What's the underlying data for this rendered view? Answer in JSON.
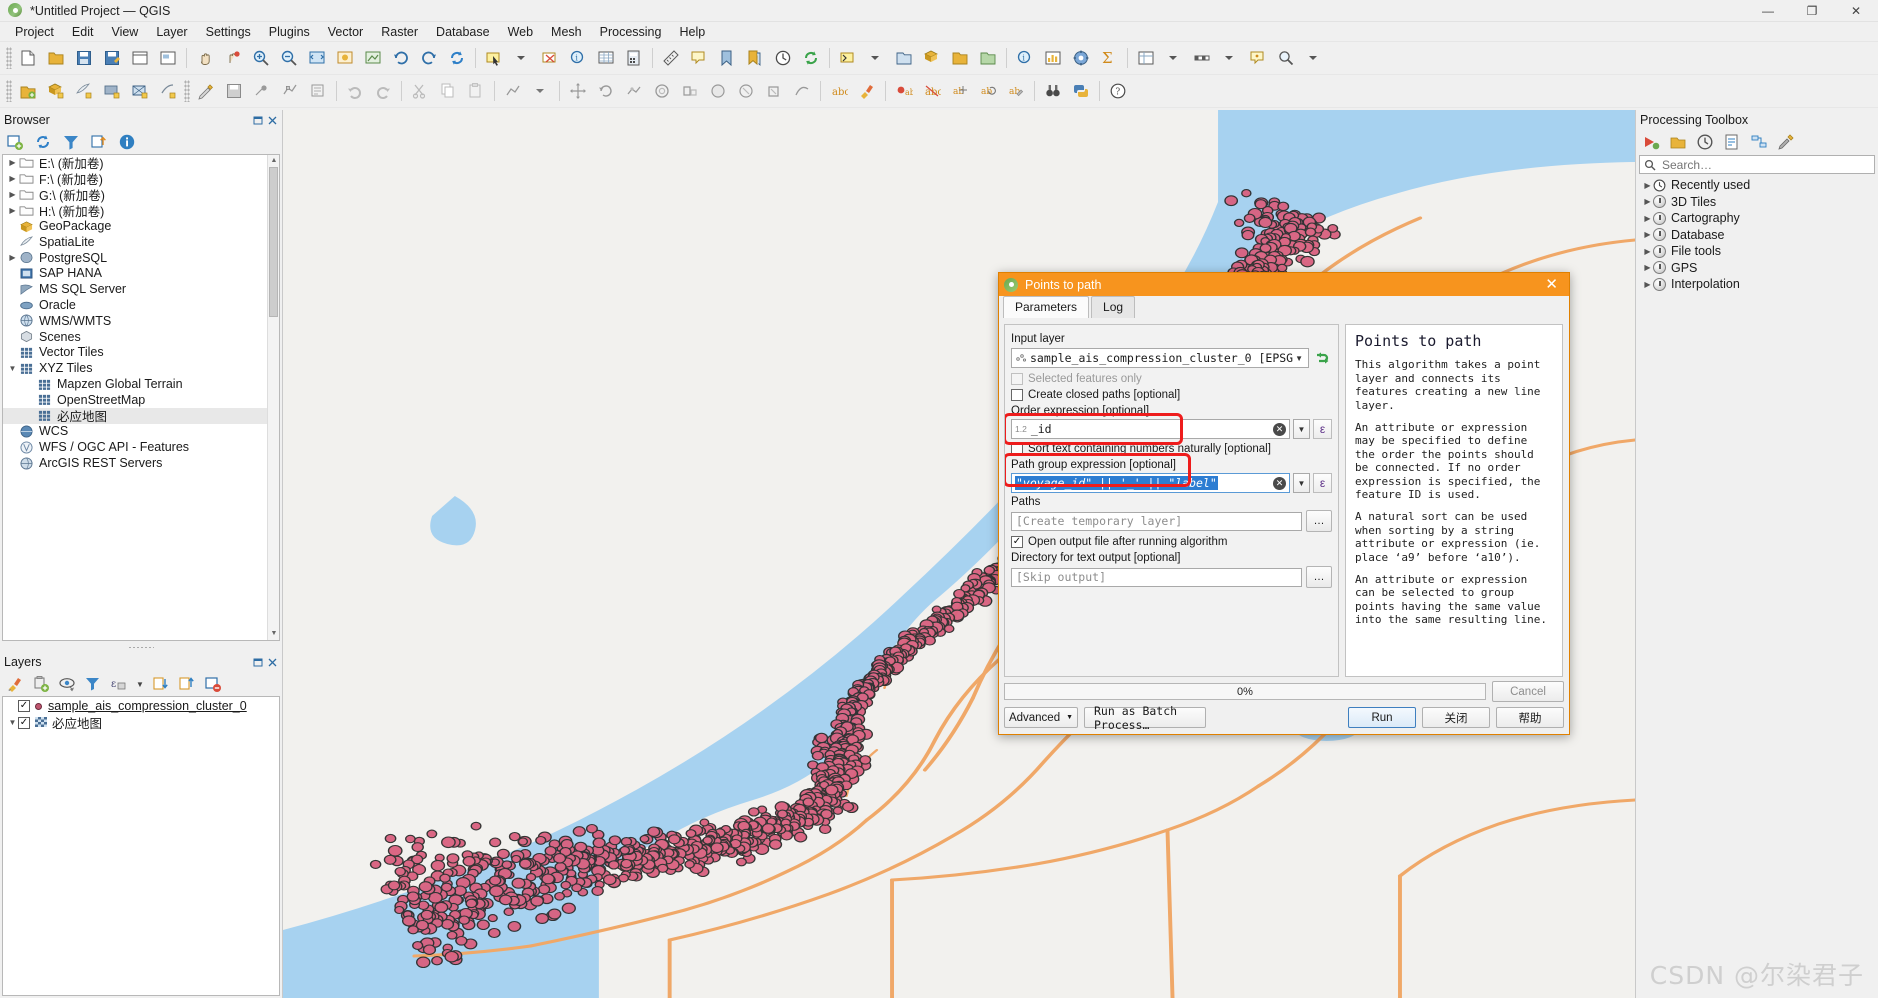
{
  "window": {
    "title": "*Untitled Project — QGIS",
    "controls": {
      "minimize": "—",
      "maximize": "❐",
      "close": "✕"
    }
  },
  "menubar": [
    "Project",
    "Edit",
    "View",
    "Layer",
    "Settings",
    "Plugins",
    "Vector",
    "Raster",
    "Database",
    "Web",
    "Mesh",
    "Processing",
    "Help"
  ],
  "browser": {
    "title": "Browser",
    "tools": [
      "add-layer-icon",
      "refresh-icon",
      "filter-icon",
      "collapse-all-icon",
      "properties-icon"
    ],
    "items": [
      {
        "label": "E:\\ (新加卷)",
        "icon": "folder-icon",
        "arrow": true,
        "indent": 0
      },
      {
        "label": "F:\\ (新加卷)",
        "icon": "folder-icon",
        "arrow": true,
        "indent": 0
      },
      {
        "label": "G:\\ (新加卷)",
        "icon": "folder-icon",
        "arrow": true,
        "indent": 0
      },
      {
        "label": "H:\\ (新加卷)",
        "icon": "folder-icon",
        "arrow": true,
        "indent": 0
      },
      {
        "label": "GeoPackage",
        "icon": "geopackage-icon",
        "arrow": false,
        "indent": 0
      },
      {
        "label": "SpatiaLite",
        "icon": "spatialite-icon",
        "arrow": false,
        "indent": 0
      },
      {
        "label": "PostgreSQL",
        "icon": "postgres-icon",
        "arrow": true,
        "indent": 0
      },
      {
        "label": "SAP HANA",
        "icon": "saphana-icon",
        "arrow": false,
        "indent": 0
      },
      {
        "label": "MS SQL Server",
        "icon": "mssql-icon",
        "arrow": false,
        "indent": 0
      },
      {
        "label": "Oracle",
        "icon": "oracle-icon",
        "arrow": false,
        "indent": 0
      },
      {
        "label": "WMS/WMTS",
        "icon": "wms-icon",
        "arrow": false,
        "indent": 0
      },
      {
        "label": "Scenes",
        "icon": "scenes-icon",
        "arrow": false,
        "indent": 0
      },
      {
        "label": "Vector Tiles",
        "icon": "vectortiles-icon",
        "arrow": false,
        "indent": 0
      },
      {
        "label": "XYZ Tiles",
        "icon": "xyztiles-icon",
        "arrow": true,
        "expanded": true,
        "indent": 0
      },
      {
        "label": "Mapzen Global Terrain",
        "icon": "xyztiles-icon",
        "arrow": false,
        "indent": 1
      },
      {
        "label": "OpenStreetMap",
        "icon": "xyztiles-icon",
        "arrow": false,
        "indent": 1
      },
      {
        "label": "必应地图",
        "icon": "xyztiles-icon",
        "arrow": false,
        "indent": 1,
        "selected": true
      },
      {
        "label": "WCS",
        "icon": "wcs-icon",
        "arrow": false,
        "indent": 0
      },
      {
        "label": "WFS / OGC API - Features",
        "icon": "wfs-icon",
        "arrow": false,
        "indent": 0
      },
      {
        "label": "ArcGIS REST Servers",
        "icon": "arcgis-icon",
        "arrow": false,
        "indent": 0
      }
    ]
  },
  "layers": {
    "title": "Layers",
    "tools": [
      "style-manager-icon",
      "add-group-icon",
      "visibility-icon",
      "filter-legend-icon",
      "expression-filter-icon",
      "expand-all-icon",
      "collapse-all-icon",
      "remove-layer-icon"
    ],
    "items": [
      {
        "label": "sample_ais_compression_cluster_0",
        "checked": true,
        "symbol": "point-symbol",
        "arrow": false,
        "underline": true
      },
      {
        "label": "必应地图",
        "checked": true,
        "symbol": "raster-symbol",
        "arrow": true,
        "underline": false
      }
    ]
  },
  "processing_toolbox": {
    "title": "Processing Toolbox",
    "tools": [
      "run-model-icon",
      "open-model-icon",
      "history-icon",
      "results-icon",
      "edit-model-icon",
      "options-icon"
    ],
    "search_placeholder": "Search…",
    "items": [
      {
        "label": "Recently used",
        "icon": "clock-icon",
        "arrow": true
      },
      {
        "label": "3D Tiles",
        "icon": "provider-icon",
        "arrow": true
      },
      {
        "label": "Cartography",
        "icon": "provider-icon",
        "arrow": true
      },
      {
        "label": "Database",
        "icon": "provider-icon",
        "arrow": true
      },
      {
        "label": "File tools",
        "icon": "provider-icon",
        "arrow": true
      },
      {
        "label": "GPS",
        "icon": "provider-icon",
        "arrow": true
      },
      {
        "label": "Interpolation",
        "icon": "provider-icon",
        "arrow": true
      }
    ]
  },
  "dialog": {
    "title": "Points to path",
    "close_label": "✕",
    "tabs": [
      {
        "label": "Parameters",
        "active": true
      },
      {
        "label": "Log",
        "active": false
      }
    ],
    "fields": {
      "input_layer_label": "Input layer",
      "input_layer_value": "sample_ais_compression_cluster_0 [EPSG",
      "selected_features_label": "Selected features only",
      "selected_features_checked": false,
      "selected_features_disabled": true,
      "create_closed_paths_label": "Create closed paths [optional]",
      "create_closed_paths_checked": false,
      "order_expression_label": "Order expression [optional]",
      "order_expression_value": "_id",
      "order_expression_prefix": "1.2",
      "natural_sort_label": "Sort text containing numbers naturally [optional]",
      "natural_sort_checked": false,
      "path_group_label": "Path group expression [optional]",
      "path_group_value": "\"voyage_id\" || '_' || \"label\"",
      "paths_label": "Paths",
      "paths_value": "[Create temporary layer]",
      "open_output_label": "Open output file after running algorithm",
      "open_output_checked": true,
      "directory_label": "Directory for text output [optional]",
      "directory_value": "[Skip output]",
      "ellipsis_label": "…",
      "expression_button_label": "ε"
    },
    "help": {
      "title": "Points to path",
      "paragraphs": [
        "This algorithm takes a point layer and connects its features creating a new line layer.",
        "An attribute or expression may be specified to define the order the points should be connected. If no order expression is specified, the feature ID is used.",
        "A natural sort can be used when sorting by a string attribute or expression (ie. place ‘a9’ before ‘a10’).",
        "An attribute or expression can be selected to group points having the same value into the same resulting line."
      ]
    },
    "footer": {
      "progress_text": "0%",
      "progress_value": 0,
      "cancel_label": "Cancel",
      "advanced_label": "Advanced",
      "batch_label": "Run as Batch Process…",
      "run_label": "Run",
      "close_label": "关闭",
      "help_label": "帮助"
    }
  },
  "watermark": "CSDN @尔染君子",
  "colors": {
    "dialog_accent": "#f7941e",
    "annotation": "#ee1c1c",
    "water": "#a7d2f0",
    "land": "#f2f1ee",
    "road": "#f0a868",
    "point_fill": "#d9607f",
    "point_stroke": "#2b2b2b"
  }
}
